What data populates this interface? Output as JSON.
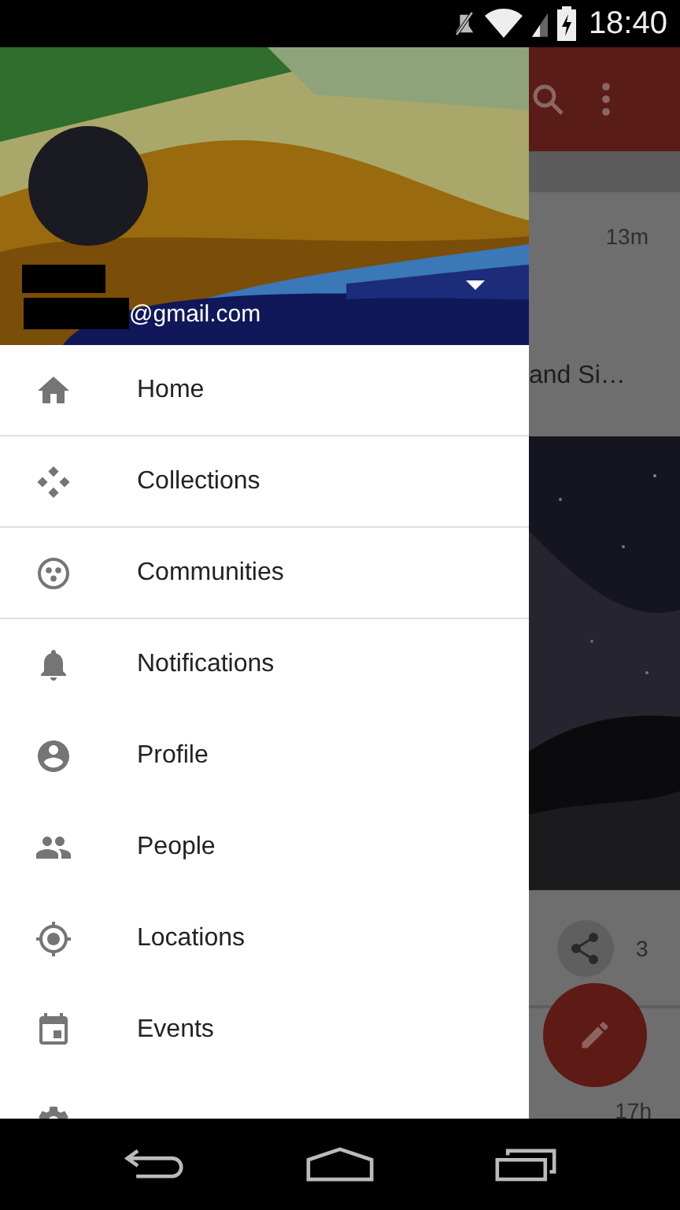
{
  "status_bar": {
    "time": "18:40"
  },
  "drawer": {
    "account": {
      "email": "@gmail.com"
    },
    "items": [
      {
        "label": "Home",
        "kind": "home",
        "divider_after": true
      },
      {
        "label": "Collections",
        "kind": "collections",
        "divider_after": true
      },
      {
        "label": "Communities",
        "kind": "communities",
        "divider_after": true
      },
      {
        "label": "Notifications",
        "kind": "bell",
        "divider_after": false
      },
      {
        "label": "Profile",
        "kind": "profile",
        "divider_after": false
      },
      {
        "label": "People",
        "kind": "people",
        "divider_after": false
      },
      {
        "label": "Locations",
        "kind": "location",
        "divider_after": false
      },
      {
        "label": "Events",
        "kind": "calendar",
        "divider_after": false
      },
      {
        "kind": "gear"
      }
    ]
  },
  "feed": {
    "post_time": "13m",
    "post_title": "and Si…",
    "share_count": "3",
    "next_post_time": "17h"
  }
}
